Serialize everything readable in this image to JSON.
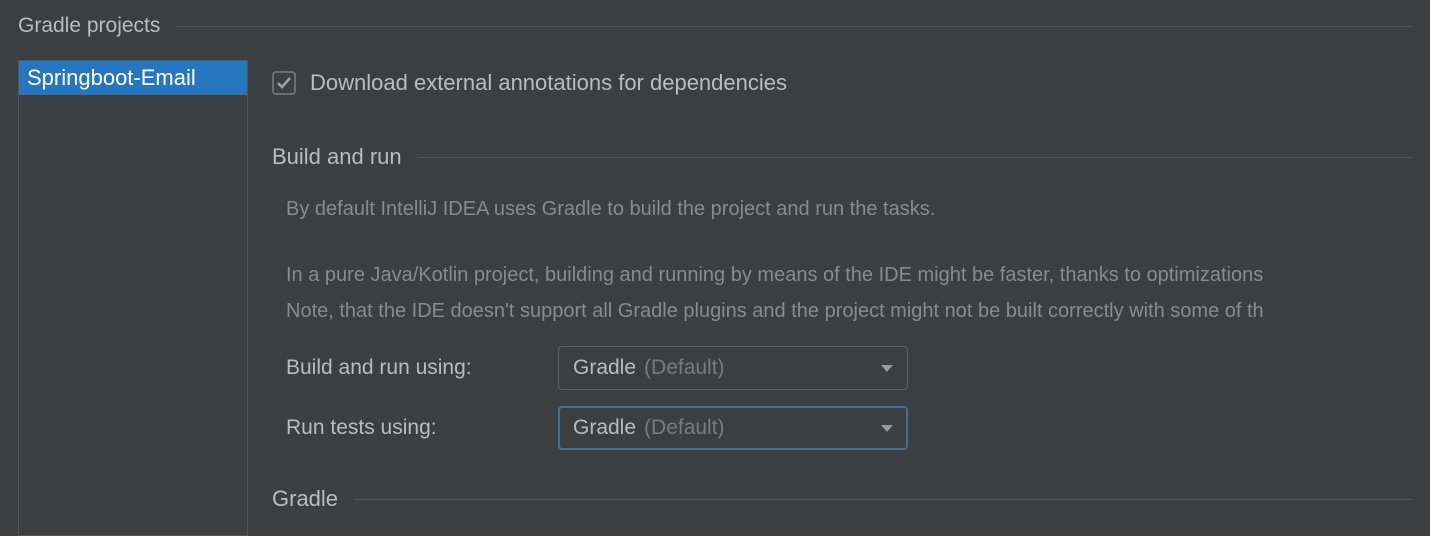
{
  "section": {
    "title": "Gradle projects"
  },
  "projects": {
    "items": [
      "Springboot-Email"
    ]
  },
  "checkbox": {
    "label": "Download external annotations for dependencies",
    "checked": true
  },
  "buildrun": {
    "title": "Build and run",
    "desc1": "By default IntelliJ IDEA uses Gradle to build the project and run the tasks.",
    "desc2": "In a pure Java/Kotlin project, building and running by means of the IDE might be faster, thanks to optimizations",
    "desc3": "Note, that the IDE doesn't support all Gradle plugins and the project might not be built correctly with some of th"
  },
  "form": {
    "buildLabel": "Build and run using:",
    "buildValue": "Gradle",
    "buildDefault": "(Default)",
    "testsLabel": "Run tests using:",
    "testsValue": "Gradle",
    "testsDefault": "(Default)"
  },
  "gradle": {
    "title": "Gradle"
  }
}
